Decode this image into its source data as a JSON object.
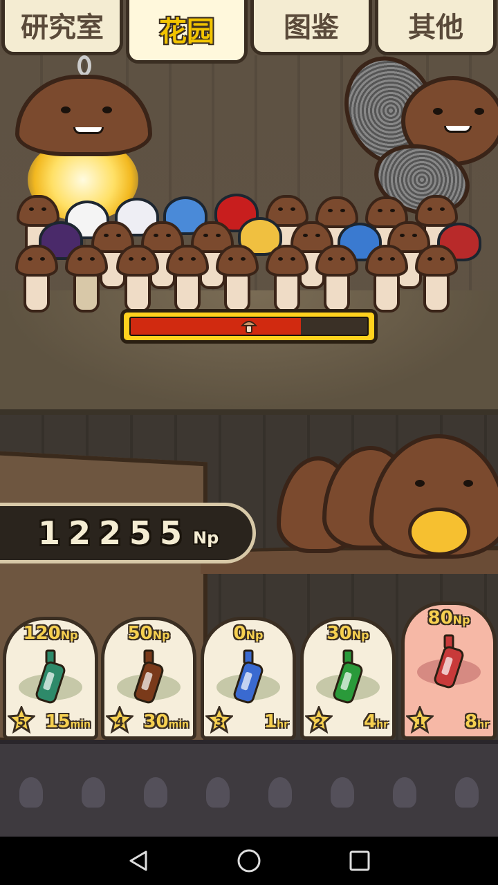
{
  "tabs": [
    {
      "label": "研究室",
      "active": false
    },
    {
      "label": "花园",
      "active": true
    },
    {
      "label": "图鉴",
      "active": false
    },
    {
      "label": "其他",
      "active": false
    }
  ],
  "harvest_progress": 0.72,
  "currency": {
    "value": "12255",
    "unit": "Np"
  },
  "items": [
    {
      "price": "120",
      "unit": "Np",
      "level": "5",
      "time_value": "15",
      "time_unit": "min",
      "color": "#2e8a6a",
      "selected": false
    },
    {
      "price": "50",
      "unit": "Np",
      "level": "4",
      "time_value": "30",
      "time_unit": "min",
      "color": "#7a3a1a",
      "selected": false
    },
    {
      "price": "0",
      "unit": "Np",
      "level": "3",
      "time_value": "1",
      "time_unit": "hr",
      "color": "#3a6ad0",
      "selected": false
    },
    {
      "price": "30",
      "unit": "Np",
      "level": "2",
      "time_value": "4",
      "time_unit": "hr",
      "color": "#2a9a3a",
      "selected": false
    },
    {
      "price": "80",
      "unit": "Np",
      "level": "1",
      "time_value": "8",
      "time_unit": "hr",
      "color": "#c83a3a",
      "selected": true
    }
  ],
  "colors": {
    "accent": "#f6d050",
    "progress_fill": "#d12a10",
    "progress_frame": "#ffd21e",
    "cap": "#7b4a2e"
  },
  "nav": {
    "back": "back-icon",
    "home": "home-icon",
    "recent": "recent-apps-icon"
  }
}
